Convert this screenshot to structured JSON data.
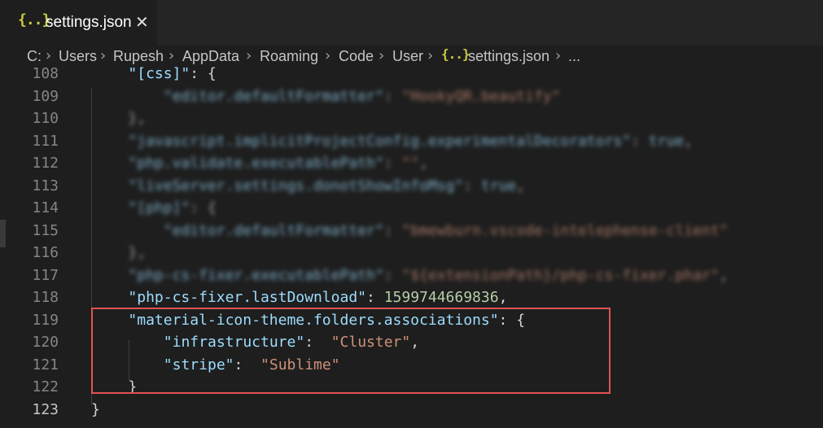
{
  "tab": {
    "icon": "json-file-icon",
    "icon_glyph": "{..}",
    "label": "settings.json",
    "close": "✕"
  },
  "breadcrumb": {
    "items": [
      "C:",
      "Users",
      "Rupesh",
      "AppData",
      "Roaming",
      "Code",
      "User",
      "settings.json",
      "..."
    ],
    "separator": "›",
    "file_icon_glyph": "{..}"
  },
  "editor": {
    "lines": [
      {
        "num": "108",
        "tokens": [
          {
            "t": "\"[css]\"",
            "c": "k"
          },
          {
            "t": ": {",
            "c": "p"
          }
        ],
        "indent": 2,
        "blur": false
      },
      {
        "num": "109",
        "tokens": [
          {
            "t": "\"editor.defaultFormatter\"",
            "c": "k"
          },
          {
            "t": ": ",
            "c": "p"
          },
          {
            "t": "\"HookyQR.beautify\"",
            "c": "s"
          }
        ],
        "indent": 4,
        "blur": true
      },
      {
        "num": "110",
        "tokens": [
          {
            "t": "},",
            "c": "p"
          }
        ],
        "indent": 2,
        "blur": true
      },
      {
        "num": "111",
        "tokens": [
          {
            "t": "\"javascript.implicitProjectConfig.experimentalDecorators\"",
            "c": "k"
          },
          {
            "t": ": ",
            "c": "p"
          },
          {
            "t": "true",
            "c": "k"
          },
          {
            "t": ",",
            "c": "p"
          }
        ],
        "indent": 2,
        "blur": true
      },
      {
        "num": "112",
        "tokens": [
          {
            "t": "\"php.validate.executablePath\"",
            "c": "k"
          },
          {
            "t": ": ",
            "c": "p"
          },
          {
            "t": "\"\"",
            "c": "s"
          },
          {
            "t": ",",
            "c": "p"
          }
        ],
        "indent": 2,
        "blur": true
      },
      {
        "num": "113",
        "tokens": [
          {
            "t": "\"liveServer.settings.donotShowInfoMsg\"",
            "c": "k"
          },
          {
            "t": ": ",
            "c": "p"
          },
          {
            "t": "true",
            "c": "k"
          },
          {
            "t": ",",
            "c": "p"
          }
        ],
        "indent": 2,
        "blur": true
      },
      {
        "num": "114",
        "tokens": [
          {
            "t": "\"[php]\"",
            "c": "k"
          },
          {
            "t": ": {",
            "c": "p"
          }
        ],
        "indent": 2,
        "blur": true
      },
      {
        "num": "115",
        "tokens": [
          {
            "t": "\"editor.defaultFormatter\"",
            "c": "k"
          },
          {
            "t": ": ",
            "c": "p"
          },
          {
            "t": "\"bmewburn.vscode-intelephense-client\"",
            "c": "s"
          }
        ],
        "indent": 4,
        "blur": true
      },
      {
        "num": "116",
        "tokens": [
          {
            "t": "},",
            "c": "p"
          }
        ],
        "indent": 2,
        "blur": true
      },
      {
        "num": "117",
        "tokens": [
          {
            "t": "\"php-cs-fixer.executablePath\"",
            "c": "k"
          },
          {
            "t": ": ",
            "c": "p"
          },
          {
            "t": "\"${extensionPath}/php-cs-fixer.phar\"",
            "c": "s"
          },
          {
            "t": ",",
            "c": "p"
          }
        ],
        "indent": 2,
        "blur": true
      },
      {
        "num": "118",
        "tokens": [
          {
            "t": "\"php-cs-fixer.lastDownload\"",
            "c": "k"
          },
          {
            "t": ": ",
            "c": "p"
          },
          {
            "t": "1599744669836",
            "c": "n"
          },
          {
            "t": ",",
            "c": "p"
          }
        ],
        "indent": 2,
        "blur": false
      },
      {
        "num": "119",
        "tokens": [
          {
            "t": "\"material-icon-theme.folders.associations\"",
            "c": "k"
          },
          {
            "t": ": {",
            "c": "p"
          }
        ],
        "indent": 2,
        "blur": false
      },
      {
        "num": "120",
        "tokens": [
          {
            "t": "\"infrastructure\"",
            "c": "k"
          },
          {
            "t": ":  ",
            "c": "p"
          },
          {
            "t": "\"Cluster\"",
            "c": "s"
          },
          {
            "t": ",",
            "c": "p"
          }
        ],
        "indent": 4,
        "blur": false
      },
      {
        "num": "121",
        "tokens": [
          {
            "t": "\"stripe\"",
            "c": "k"
          },
          {
            "t": ":  ",
            "c": "p"
          },
          {
            "t": "\"Sublime\"",
            "c": "s"
          }
        ],
        "indent": 4,
        "blur": false
      },
      {
        "num": "122",
        "tokens": [
          {
            "t": "}",
            "c": "p"
          }
        ],
        "indent": 2,
        "blur": false
      },
      {
        "num": "123",
        "tokens": [
          {
            "t": "}",
            "c": "p"
          }
        ],
        "indent": 0,
        "blur": false
      }
    ],
    "active_line": "123"
  },
  "colors": {
    "highlight_box": "#e05252",
    "json_icon": "#cbcb41"
  }
}
